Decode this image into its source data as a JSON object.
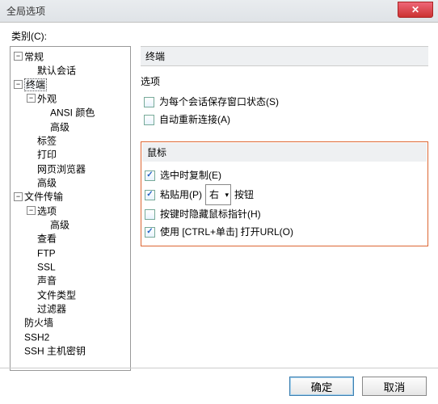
{
  "window": {
    "title": "全局选项"
  },
  "category_label": "类别(C):",
  "tree": {
    "n0": {
      "label": "常规",
      "children": [
        "n0_0"
      ]
    },
    "n0_0": {
      "label": "默认会话"
    },
    "n1": {
      "label": "终端",
      "selected": true,
      "children": [
        "n1_0",
        "n1_1",
        "n1_2",
        "n1_3",
        "n1_4"
      ]
    },
    "n1_0": {
      "label": "外观",
      "children": [
        "n1_0_0",
        "n1_0_1"
      ]
    },
    "n1_0_0": {
      "label": "ANSI 颜色"
    },
    "n1_0_1": {
      "label": "高级"
    },
    "n1_1": {
      "label": "标签"
    },
    "n1_2": {
      "label": "打印"
    },
    "n1_3": {
      "label": "网页浏览器"
    },
    "n1_4": {
      "label": "高级"
    },
    "n2": {
      "label": "文件传输",
      "children": [
        "n2_0",
        "n2_1",
        "n2_2",
        "n2_3",
        "n2_4",
        "n2_5",
        "n2_6"
      ]
    },
    "n2_0": {
      "label": "选项",
      "children": [
        "n2_0_0"
      ]
    },
    "n2_0_0": {
      "label": "高级"
    },
    "n2_1": {
      "label": "查看"
    },
    "n2_2": {
      "label": "FTP"
    },
    "n2_3": {
      "label": "SSL"
    },
    "n2_4": {
      "label": "声音"
    },
    "n2_5": {
      "label": "文件类型"
    },
    "n2_6": {
      "label": "过滤器"
    },
    "n3": {
      "label": "防火墙"
    },
    "n4": {
      "label": "SSH2"
    },
    "n5": {
      "label": "SSH 主机密钥"
    }
  },
  "panel": {
    "header": "终端",
    "options_title": "选项",
    "opt_save_state": {
      "label": "为每个会话保存窗口状态(S)",
      "checked": false
    },
    "opt_auto_reconnect": {
      "label": "自动重新连接(A)",
      "checked": false
    },
    "mouse_title": "鼠标",
    "opt_copy": {
      "label": "选中时复制(E)",
      "checked": true
    },
    "opt_paste": {
      "prefix": "粘贴用(P)",
      "value": "右",
      "suffix": "按钮",
      "checked": true
    },
    "opt_hide_pointer": {
      "label": "按键时隐藏鼠标指针(H)",
      "checked": false
    },
    "opt_ctrl_click": {
      "label": "使用 [CTRL+单击] 打开URL(O)",
      "checked": true
    }
  },
  "buttons": {
    "ok": "确定",
    "cancel": "取消"
  }
}
